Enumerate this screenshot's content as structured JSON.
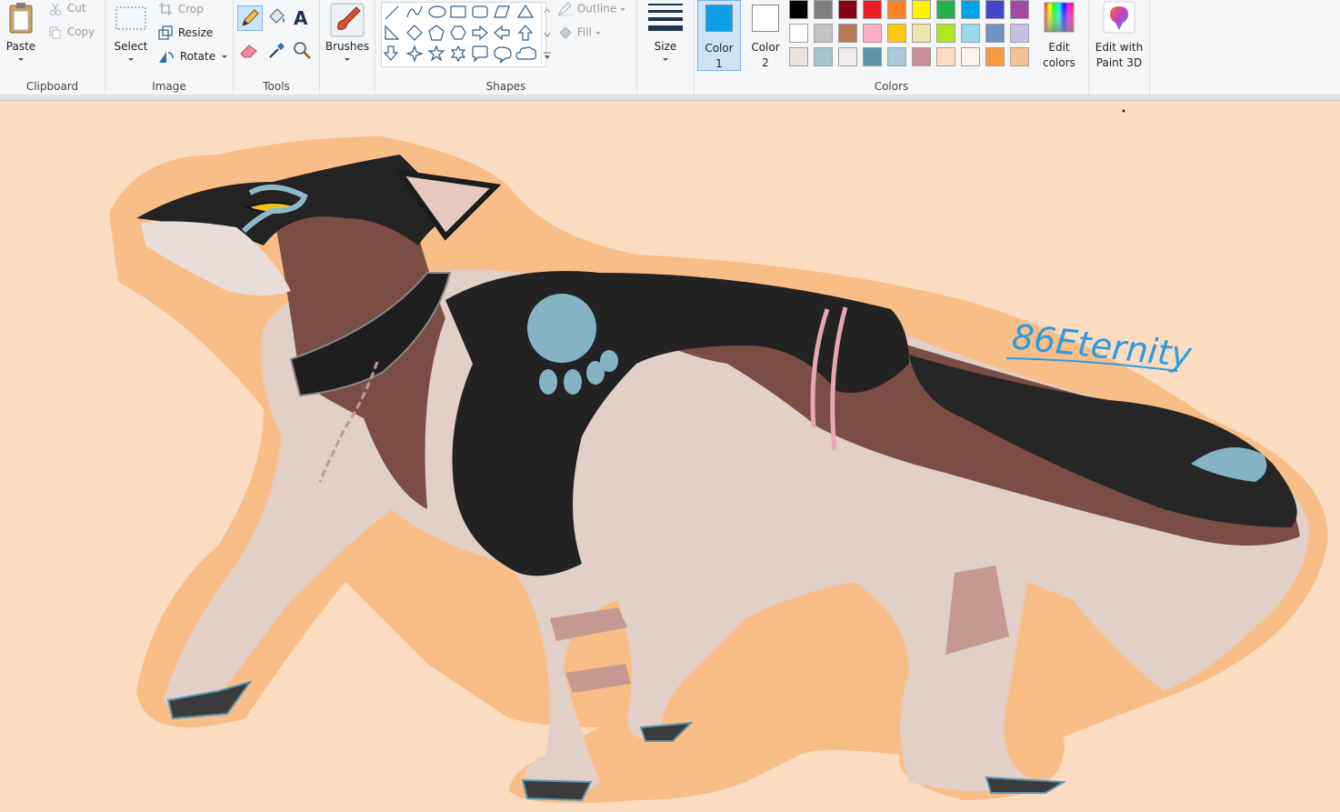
{
  "ribbon": {
    "clipboard": {
      "group_label": "Clipboard",
      "paste": "Paste",
      "cut": "Cut",
      "copy": "Copy"
    },
    "image": {
      "group_label": "Image",
      "select": "Select",
      "crop": "Crop",
      "resize": "Resize",
      "rotate": "Rotate"
    },
    "tools": {
      "group_label": "Tools"
    },
    "brushes": {
      "label": "Brushes"
    },
    "shapes": {
      "group_label": "Shapes",
      "outline": "Outline",
      "fill": "Fill"
    },
    "size": {
      "label": "Size"
    },
    "colors": {
      "group_label": "Colors",
      "color1_line1": "Color",
      "color1_line2": "1",
      "color2_line1": "Color",
      "color2_line2": "2",
      "color1": "#0aa1e8",
      "color2": "#ffffff",
      "edit_line1": "Edit",
      "edit_line2": "colors",
      "palette_row1": [
        "#000000",
        "#7f7f7f",
        "#880015",
        "#ed1c24",
        "#ff7f27",
        "#fff200",
        "#22b14c",
        "#00a2e8",
        "#3f48cc",
        "#a349a4"
      ],
      "palette_row2": [
        "#ffffff",
        "#c3c3c3",
        "#b97a57",
        "#ffaec9",
        "#ffc90e",
        "#efe4b0",
        "#b5e61d",
        "#99d9ea",
        "#7092be",
        "#c8bfe7"
      ],
      "palette_row3": [
        "#ede2e0",
        "#a5c6d0",
        "#f2ecea",
        "#5b93a8",
        "#a9cbd8",
        "#c98e96",
        "#fddcc4",
        "#fff4ea",
        "#f99a3c",
        "#f7c196"
      ]
    },
    "paint3d": {
      "line1": "Edit with",
      "line2": "Paint 3D"
    }
  },
  "canvas": {
    "background": "#fbdcc0",
    "signature": "86Eternity"
  }
}
